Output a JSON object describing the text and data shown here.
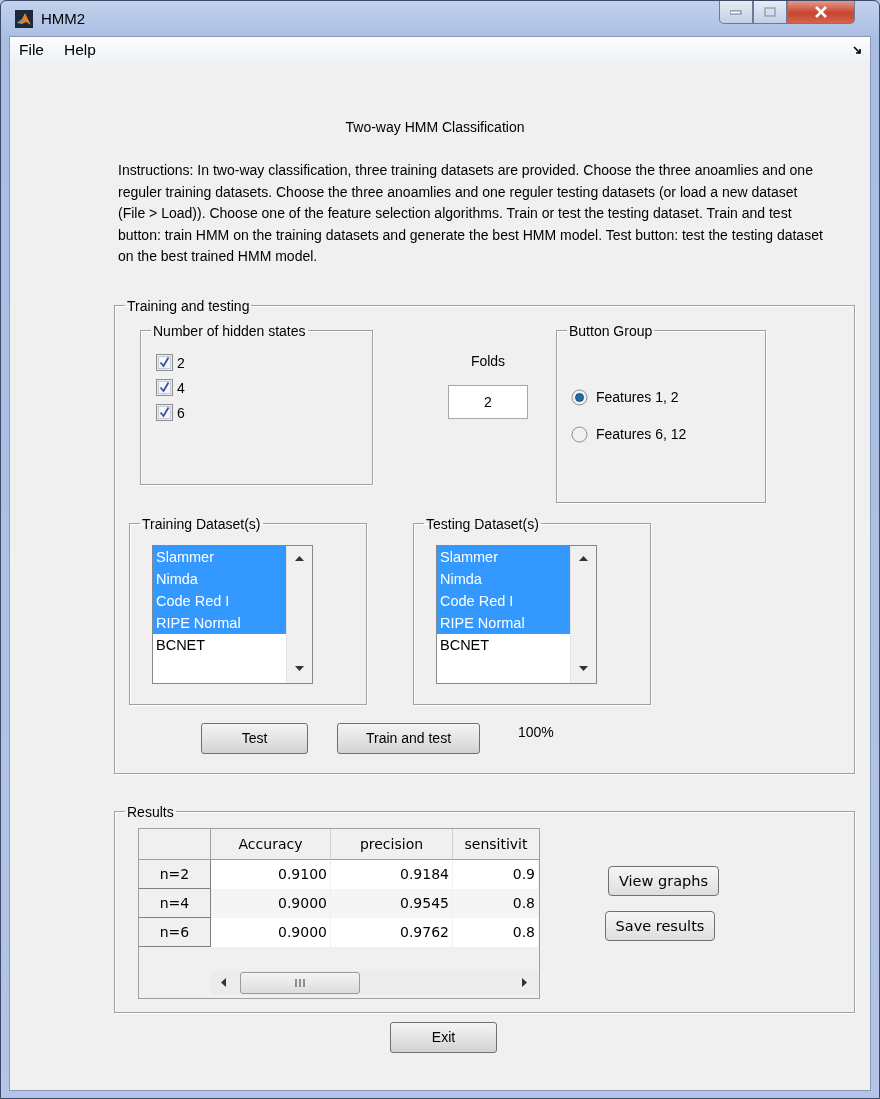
{
  "window": {
    "title": "HMM2"
  },
  "menu": [
    {
      "label": "File"
    },
    {
      "label": "Help"
    }
  ],
  "heading": "Two-way HMM Classification",
  "instructions": "Instructions: In two-way classification, three training datasets are provided. Choose the three anoamlies and one reguler training datasets. Choose the three anoamlies and one reguler testing datasets (or load a new dataset (File > Load)). Choose one of the feature selection algorithms. Train or test the testing dataset. Train and test button: train HMM on the training datasets and generate the best HMM model. Test button: test the testing dataset on the best trained HMM model.",
  "training_panel": {
    "title": "Training and testing",
    "hidden_states": {
      "title": "Number of hidden states",
      "options": [
        {
          "label": "2",
          "checked": true
        },
        {
          "label": "4",
          "checked": true
        },
        {
          "label": "6",
          "checked": true
        }
      ]
    },
    "folds": {
      "label": "Folds",
      "value": "2"
    },
    "button_group": {
      "title": "Button Group",
      "options": [
        {
          "label": "Features 1, 2",
          "selected": true
        },
        {
          "label": "Features 6, 12",
          "selected": false
        }
      ]
    },
    "training_datasets": {
      "title": "Training Dataset(s)",
      "items": [
        {
          "label": "Slammer",
          "selected": true
        },
        {
          "label": "Nimda",
          "selected": true
        },
        {
          "label": "Code Red I",
          "selected": true
        },
        {
          "label": "RIPE Normal",
          "selected": true
        },
        {
          "label": "BCNET",
          "selected": false
        }
      ]
    },
    "testing_datasets": {
      "title": "Testing Dataset(s)",
      "items": [
        {
          "label": "Slammer",
          "selected": true
        },
        {
          "label": "Nimda",
          "selected": true
        },
        {
          "label": "Code Red I",
          "selected": true
        },
        {
          "label": "RIPE Normal",
          "selected": true
        },
        {
          "label": "BCNET",
          "selected": false
        }
      ]
    },
    "buttons": [
      "Test",
      "Train and test"
    ],
    "progress": "100%"
  },
  "results": {
    "title": "Results",
    "table": {
      "columns": [
        "Accuracy",
        "precision",
        "sensitivit"
      ],
      "rows": [
        {
          "header": "n=2",
          "cells": [
            "0.9100",
            "0.9184",
            "0.9"
          ]
        },
        {
          "header": "n=4",
          "cells": [
            "0.9000",
            "0.9545",
            "0.8"
          ]
        },
        {
          "header": "n=6",
          "cells": [
            "0.9000",
            "0.9762",
            "0.8"
          ]
        }
      ]
    },
    "buttons": [
      "View graphs",
      "Save results"
    ]
  },
  "exit": "Exit"
}
